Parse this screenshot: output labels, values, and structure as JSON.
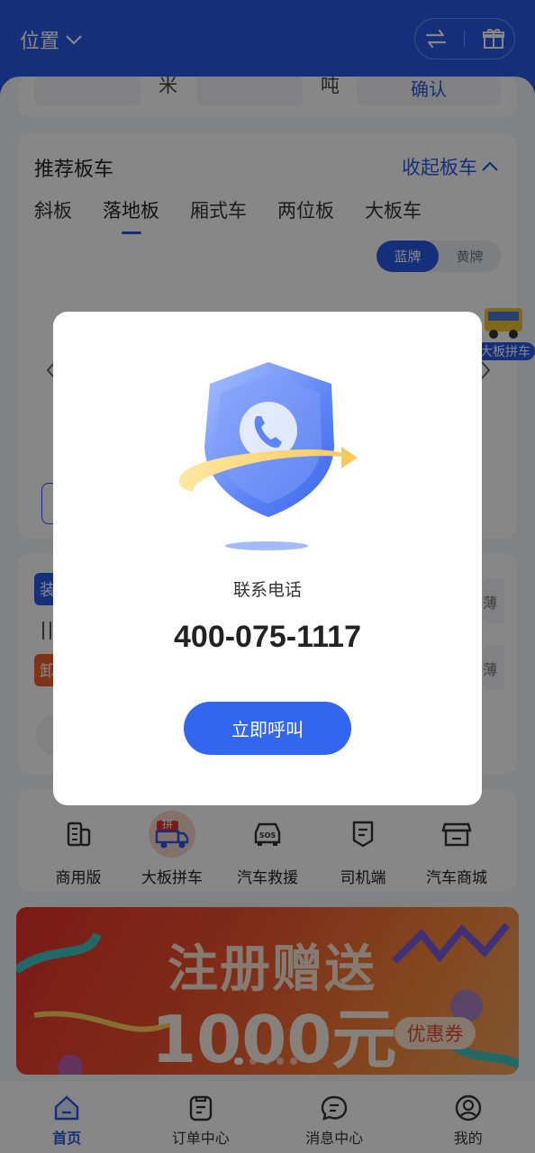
{
  "header": {
    "location_label": "位置",
    "swap_icon": "swap-icon",
    "gift_icon": "gift-icon"
  },
  "top_form": {
    "length_unit": "米",
    "weight_unit": "吨",
    "confirm_label": "确认"
  },
  "recommend": {
    "title": "推荐板车",
    "collapse_label": "收起板车",
    "tabs": [
      {
        "label": "斜板",
        "active": false
      },
      {
        "label": "落地板",
        "active": true
      },
      {
        "label": "厢式车",
        "active": false
      },
      {
        "label": "两位板",
        "active": false
      },
      {
        "label": "大板车",
        "active": false
      }
    ],
    "plate_options": [
      "蓝牌",
      "黄牌"
    ],
    "selected_plate": "蓝牌",
    "float_badge": "大板拼车"
  },
  "route_card": {
    "load_tag": "装",
    "unload_tag": "卸",
    "price_suffix": "薄"
  },
  "quick_actions": [
    {
      "label": "商用版",
      "icon": "building-icon"
    },
    {
      "label": "大板拼车",
      "icon": "carpool-truck-icon",
      "badge": "拼"
    },
    {
      "label": "汽车救援",
      "icon": "sos-car-icon"
    },
    {
      "label": "司机端",
      "icon": "driver-doc-icon"
    },
    {
      "label": "汽车商城",
      "icon": "store-icon"
    }
  ],
  "banner": {
    "headline": "注册赠送",
    "amount": "1000元",
    "coupon": "优惠券",
    "slides": 5,
    "active_slide": 1
  },
  "bottom_nav": [
    {
      "label": "首页",
      "icon": "home-icon",
      "active": true
    },
    {
      "label": "订单中心",
      "icon": "orders-icon",
      "active": false
    },
    {
      "label": "消息中心",
      "icon": "message-icon",
      "active": false
    },
    {
      "label": "我的",
      "icon": "profile-icon",
      "active": false
    }
  ],
  "modal": {
    "illustration_icon": "shield-phone-icon",
    "label": "联系电话",
    "phone": "400-075-1117",
    "call_button": "立即呼叫"
  },
  "colors": {
    "primary": "#2a59e6",
    "button": "#3366ee",
    "banner_red": "#e8322d"
  }
}
